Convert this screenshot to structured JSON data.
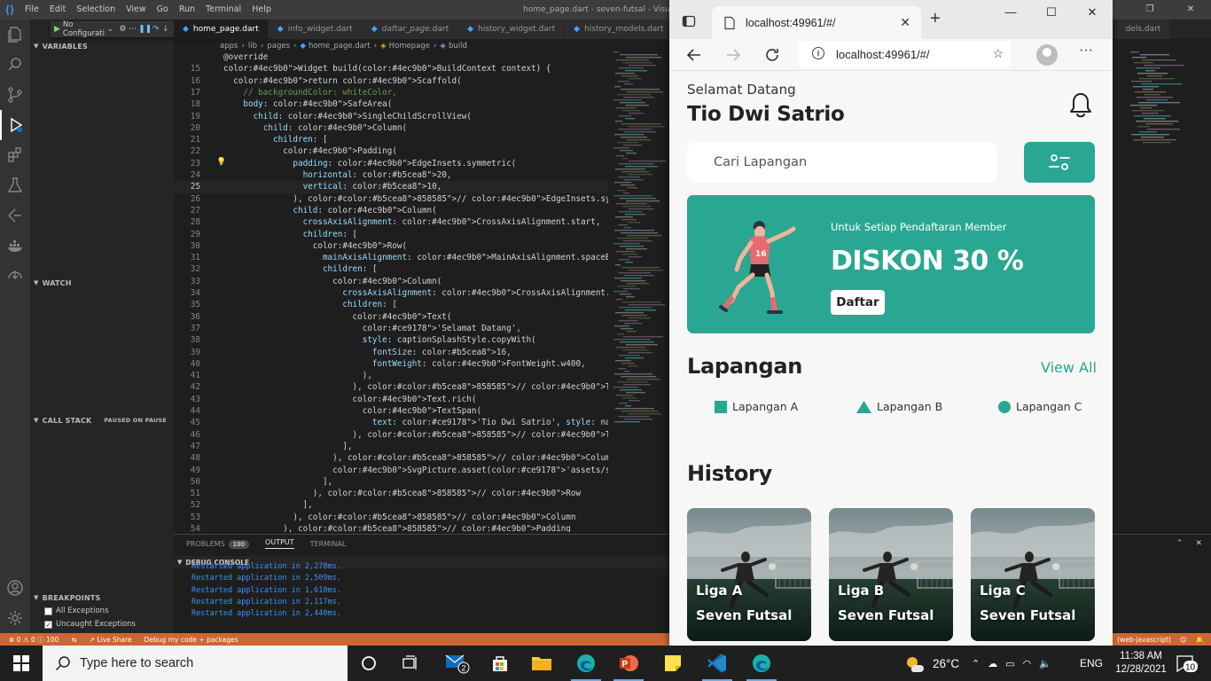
{
  "vscode": {
    "title": "home_page.dart - seven-futsal - Visual Studio Code",
    "menu": [
      "File",
      "Edit",
      "Selection",
      "View",
      "Go",
      "Run",
      "Terminal",
      "Help"
    ],
    "debug_config": "No Configurati",
    "sidebar": {
      "variables": "VARIABLES",
      "watch": "WATCH",
      "call_stack": "CALL STACK",
      "paused": "PAUSED ON PAUSE",
      "breakpoints": "BREAKPOINTS",
      "bp_all": "All Exceptions",
      "bp_uncaught": "Uncaught Exceptions"
    },
    "tabs": [
      "home_page.dart",
      "info_widget.dart",
      "daftar_page.dart",
      "history_widget.dart",
      "history_models.dart",
      "dels.dart"
    ],
    "breadcrumb": [
      "apps",
      "lib",
      "pages",
      "home_page.dart",
      "Homepage",
      "build"
    ],
    "code_lines": [
      {
        "n": "",
        "t": "@override"
      },
      {
        "n": "15",
        "t": "Widget build(BuildContext context) {"
      },
      {
        "n": "16",
        "t": "  return Scaffold("
      },
      {
        "n": "17",
        "t": "    // backgroundColor: whiteColor,"
      },
      {
        "n": "18",
        "t": "    body: SafeArea("
      },
      {
        "n": "19",
        "t": "      child: SingleChildScrollView("
      },
      {
        "n": "20",
        "t": "        child: Column("
      },
      {
        "n": "21",
        "t": "          children: ["
      },
      {
        "n": "22",
        "t": "            Padding("
      },
      {
        "n": "23",
        "t": "              padding: EdgeInsets.symmetric("
      },
      {
        "n": "24",
        "t": "                horizontal: 20,"
      },
      {
        "n": "25",
        "t": "                vertical: 10,"
      },
      {
        "n": "26",
        "t": "              ), // EdgeInsets.symmetric"
      },
      {
        "n": "27",
        "t": "              child: Column("
      },
      {
        "n": "28",
        "t": "                crossAxisAlignment: CrossAxisAlignment.start,"
      },
      {
        "n": "29",
        "t": "                children: ["
      },
      {
        "n": "30",
        "t": "                  Row("
      },
      {
        "n": "31",
        "t": "                    mainAxisAlignment: MainAxisAlignment.spaceBetween,"
      },
      {
        "n": "32",
        "t": "                    children: ["
      },
      {
        "n": "33",
        "t": "                      Column("
      },
      {
        "n": "34",
        "t": "                        crossAxisAlignment: CrossAxisAlignment.start,"
      },
      {
        "n": "35",
        "t": "                        children: ["
      },
      {
        "n": "36",
        "t": "                          Text("
      },
      {
        "n": "37",
        "t": "                            'Selamat Datang',"
      },
      {
        "n": "38",
        "t": "                            style: captionSplashStyle.copyWith("
      },
      {
        "n": "39",
        "t": "                              fontSize: 16,"
      },
      {
        "n": "40",
        "t": "                              fontWeight: FontWeight.w400,"
      },
      {
        "n": "41",
        "t": "                            ),"
      },
      {
        "n": "42",
        "t": "                          ), // Text"
      },
      {
        "n": "43",
        "t": "                          Text.rich("
      },
      {
        "n": "44",
        "t": "                            TextSpan("
      },
      {
        "n": "45",
        "t": "                              text: 'Tio Dwi Satrio', style: nameStyle), // Te"
      },
      {
        "n": "46",
        "t": "                          ), // Text.rich"
      },
      {
        "n": "47",
        "t": "                        ],"
      },
      {
        "n": "48",
        "t": "                      ), // Column"
      },
      {
        "n": "49",
        "t": "                      SvgPicture.asset('assets/svg/Notification.svg')"
      },
      {
        "n": "50",
        "t": "                    ],"
      },
      {
        "n": "51",
        "t": "                  ), // Row"
      },
      {
        "n": "52",
        "t": "                ],"
      },
      {
        "n": "53",
        "t": "              ), // Column"
      },
      {
        "n": "54",
        "t": "            ), // Padding"
      }
    ],
    "panel": {
      "tabs": [
        "PROBLEMS",
        "OUTPUT",
        "TERMINAL"
      ],
      "problems_count": "100",
      "console_title": "DEBUG CONSOLE",
      "lines": [
        "Restarted application in 2,278ms.",
        "Restarted application in 2,509ms.",
        "Restarted application in 1,610ms.",
        "Restarted application in 2,117ms.",
        "Restarted application in 2,440ms."
      ]
    },
    "status": {
      "errors": "0",
      "warnings": "0",
      "infos": "100",
      "live_share": "Live Share",
      "debug_mode": "Debug my code + packages",
      "right": "(web-javascript)"
    }
  },
  "browser": {
    "tab_title": "localhost:49961/#/",
    "url": "localhost:49961/#/"
  },
  "app": {
    "greeting": "Selamat Datang",
    "name": "Tio Dwi Satrio",
    "search_placeholder": "Cari Lapangan",
    "banner_sub": "Untuk Setiap Pendaftaran Member",
    "banner_title": "DISKON 30 %",
    "banner_button": "Daftar",
    "player_number": "16",
    "section_lapangan": "Lapangan",
    "view_all": "View All",
    "legend": [
      {
        "label": "Lapangan A",
        "shape": "square"
      },
      {
        "label": "Lapangan B",
        "shape": "triangle"
      },
      {
        "label": "Lapangan C",
        "shape": "circle"
      }
    ],
    "section_history": "History",
    "history_cards": [
      {
        "league": "Liga A",
        "title": "Seven Futsal"
      },
      {
        "league": "Liga B",
        "title": "Seven Futsal"
      },
      {
        "league": "Liga C",
        "title": "Seven Futsal"
      }
    ],
    "accent_color": "#2aa792"
  },
  "taskbar": {
    "search_placeholder": "Type here to search",
    "temperature": "26°C",
    "language": "ENG",
    "time": "11:38 AM",
    "date": "12/28/2021",
    "mail_badge": "2",
    "notification_count": "10"
  }
}
